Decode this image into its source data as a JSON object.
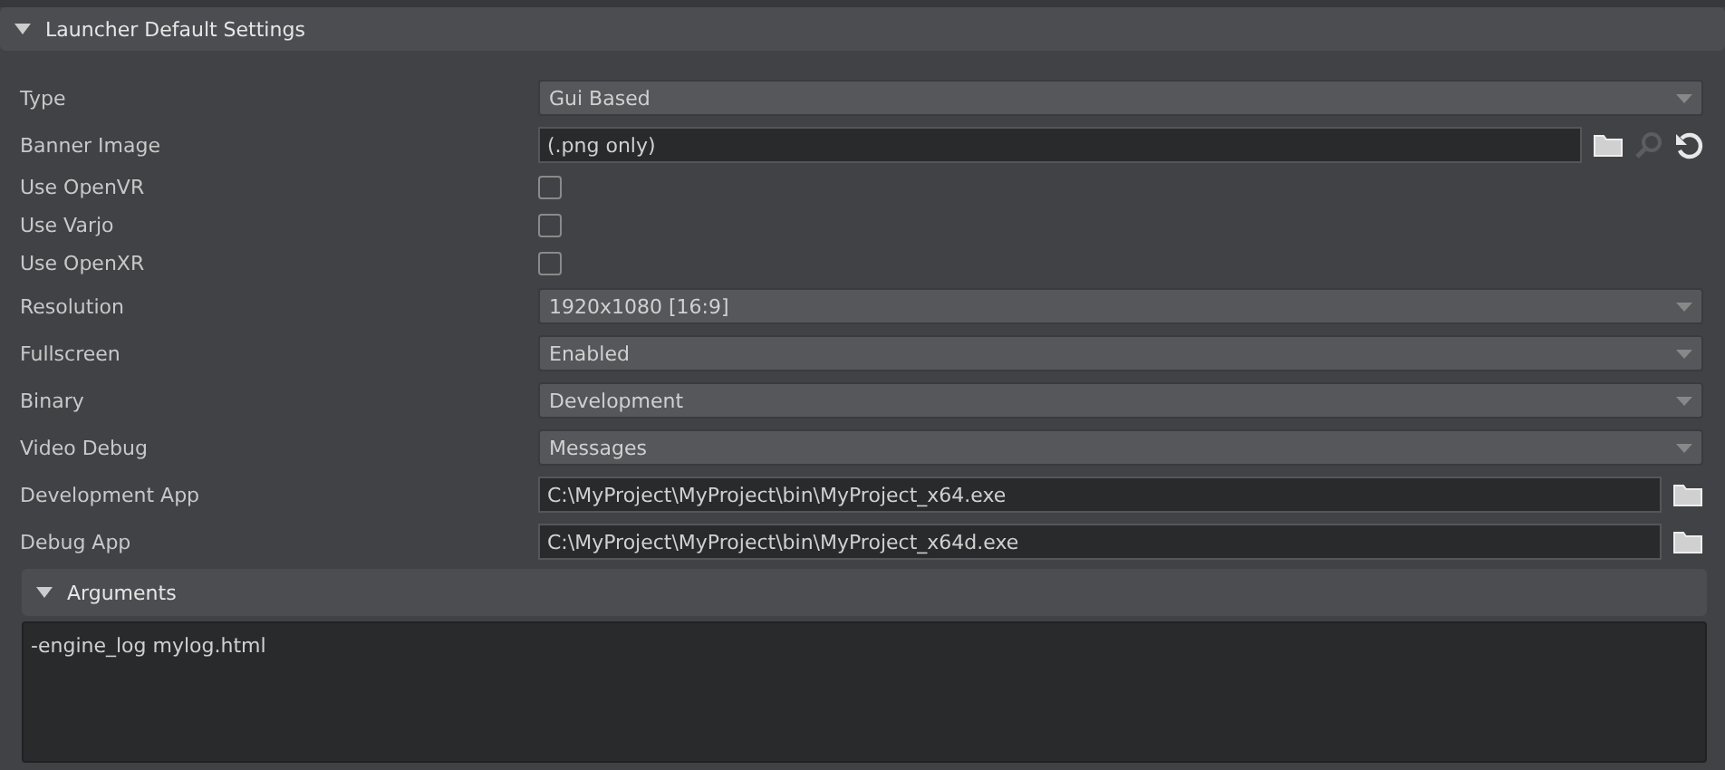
{
  "section": {
    "title": "Launcher Default Settings",
    "expanded": true
  },
  "rows": [
    {
      "kind": "dropdown",
      "label": "Type",
      "value": "Gui Based"
    },
    {
      "kind": "image",
      "label": "Banner Image",
      "placeholder": "(.png only)"
    },
    {
      "kind": "checkbox",
      "label": "Use OpenVR",
      "checked": false
    },
    {
      "kind": "checkbox",
      "label": "Use Varjo",
      "checked": false
    },
    {
      "kind": "checkbox",
      "label": "Use OpenXR",
      "checked": false
    },
    {
      "kind": "dropdown",
      "label": "Resolution",
      "value": "1920x1080 [16:9]"
    },
    {
      "kind": "dropdown",
      "label": "Fullscreen",
      "value": "Enabled"
    },
    {
      "kind": "dropdown",
      "label": "Binary",
      "value": "Development"
    },
    {
      "kind": "dropdown",
      "label": "Video Debug",
      "value": "Messages"
    },
    {
      "kind": "path",
      "label": "Development App",
      "value": "C:\\MyProject\\MyProject\\bin\\MyProject_x64.exe"
    },
    {
      "kind": "path",
      "label": "Debug App",
      "value": "C:\\MyProject\\MyProject\\bin\\MyProject_x64d.exe"
    }
  ],
  "arguments": {
    "title": "Arguments",
    "expanded": true,
    "value": "-engine_log mylog.html"
  }
}
